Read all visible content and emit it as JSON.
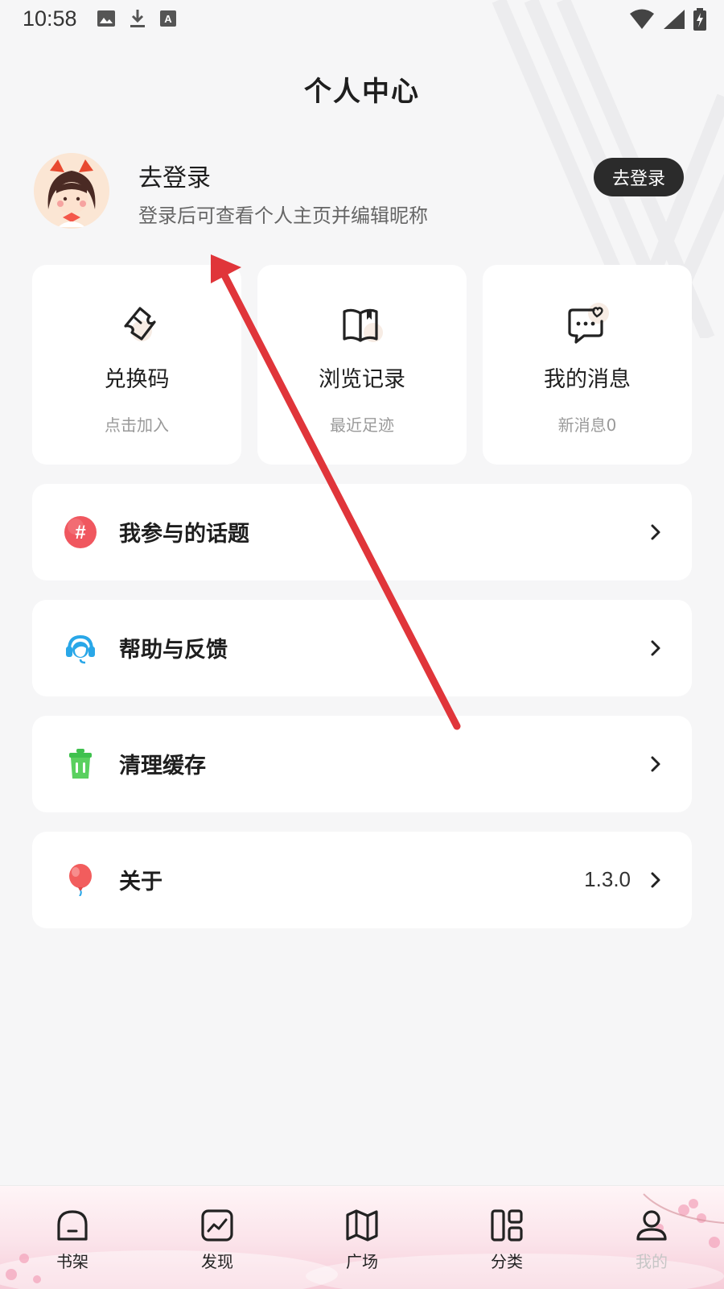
{
  "status_bar": {
    "time": "10:58",
    "left_icons": [
      "image-icon",
      "download-icon",
      "text-icon"
    ],
    "right_icons": [
      "wifi-icon",
      "signal-icon",
      "battery-charging-icon"
    ]
  },
  "header": {
    "title": "个人中心"
  },
  "profile": {
    "name": "去登录",
    "subtitle": "登录后可查看个人主页并编辑昵称",
    "login_button": "去登录"
  },
  "quick_cards": [
    {
      "icon": "ticket-icon",
      "title": "兑换码",
      "subtitle": "点击加入"
    },
    {
      "icon": "book-icon",
      "title": "浏览记录",
      "subtitle": "最近足迹"
    },
    {
      "icon": "message-heart-icon",
      "title": "我的消息",
      "subtitle": "新消息0"
    }
  ],
  "menu": [
    {
      "icon": "hashtag-icon",
      "label": "我参与的话题",
      "value": ""
    },
    {
      "icon": "headset-icon",
      "label": "帮助与反馈",
      "value": ""
    },
    {
      "icon": "trash-icon",
      "label": "清理缓存",
      "value": ""
    },
    {
      "icon": "balloon-icon",
      "label": "关于",
      "value": "1.3.0"
    }
  ],
  "bottom_nav": [
    {
      "icon": "bookshelf-icon",
      "label": "书架",
      "active": false
    },
    {
      "icon": "trend-icon",
      "label": "发现",
      "active": false
    },
    {
      "icon": "map-icon",
      "label": "广场",
      "active": false
    },
    {
      "icon": "category-icon",
      "label": "分类",
      "active": false
    },
    {
      "icon": "user-icon",
      "label": "我的",
      "active": true
    }
  ],
  "colors": {
    "background": "#f6f6f7",
    "card": "#ffffff",
    "login_button_bg": "#2b2b2b",
    "annotation_arrow": "#e0353a",
    "hashtag": "#f0575f",
    "headset": "#29a7e8",
    "trash": "#3fc14e",
    "balloon": "#f25d5d"
  }
}
